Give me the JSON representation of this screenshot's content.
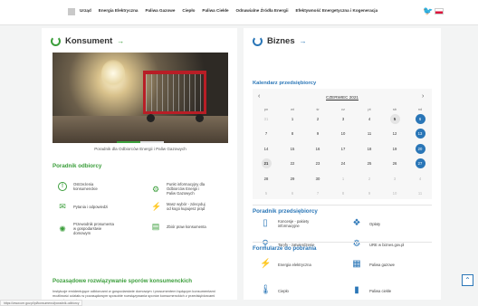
{
  "topnav": {
    "menu": [
      "Urząd",
      "Energia Elektryczna",
      "Paliwa Gazowe",
      "Ciepło",
      "Paliwa Ciekłe",
      "Odnawialne Źródła Energii",
      "Efektywność Energetyczna i Kogeneracja"
    ],
    "home_icon": "home-icon",
    "twitter_icon": "twitter-icon",
    "language_icon": "flag-icon"
  },
  "konsument": {
    "title": "Konsument",
    "arrow": "→",
    "slide_caption": "Poradnik dla Odbiorców Energii i Paliw Gazowych",
    "guide_heading": "Poradnik odbiorcy",
    "items": [
      {
        "label": "Ostrzeżenia konsumenckie",
        "icon": "warning-icon",
        "glyph": "!"
      },
      {
        "label": "Punkt informacyjny dla Odbiorców Energii i Paliw Gazowych",
        "icon": "info-point-icon",
        "glyph": "⚙"
      },
      {
        "label": "Pytania i odpowiedzi",
        "icon": "chat-icon",
        "glyph": "✉"
      },
      {
        "label": "Masz wybór - zdecyduj od kogo kupujesz prąd",
        "icon": "plug-icon",
        "glyph": "⚡"
      },
      {
        "label": "Przewodnik prosumenta w gospodarstwie domowym",
        "icon": "sun-icon",
        "glyph": "✺"
      },
      {
        "label": "Zbiór praw konsumenta",
        "icon": "book-icon",
        "glyph": "▤"
      }
    ],
    "disputes_heading": "Pozasądowe rozwiązywanie sporów konsumenckich",
    "disputes_text": "Instytucje emidentujące odbiorcami w gospodarstwie domowym i prosumentem będącym konsumentami możliwość udziału w pozasądowym sposobie rozwiązywania sporów konsumenckich z przedsiębiorcami energetycznymi"
  },
  "biznes": {
    "title": "Biznes",
    "arrow": "→",
    "calendar_heading": "Kalendarz przedsiębiorcy",
    "calendar": {
      "month": "CZERWIEC 2021",
      "prev": "‹",
      "next": "›",
      "dow": [
        "pn",
        "wt",
        "śr",
        "cz",
        "pt",
        "sb",
        "nd"
      ],
      "weeks": [
        [
          {
            "d": "31",
            "s": "dim"
          },
          {
            "d": "1"
          },
          {
            "d": "2"
          },
          {
            "d": "3"
          },
          {
            "d": "4"
          },
          {
            "d": "5",
            "s": "today"
          },
          {
            "d": "6",
            "s": "sel"
          }
        ],
        [
          {
            "d": "7"
          },
          {
            "d": "8"
          },
          {
            "d": "9"
          },
          {
            "d": "10"
          },
          {
            "d": "11"
          },
          {
            "d": "12"
          },
          {
            "d": "13",
            "s": "sel"
          }
        ],
        [
          {
            "d": "14"
          },
          {
            "d": "15"
          },
          {
            "d": "16"
          },
          {
            "d": "17"
          },
          {
            "d": "18"
          },
          {
            "d": "19"
          },
          {
            "d": "20",
            "s": "sel"
          }
        ],
        [
          {
            "d": "21",
            "s": "today"
          },
          {
            "d": "22"
          },
          {
            "d": "23"
          },
          {
            "d": "24"
          },
          {
            "d": "25"
          },
          {
            "d": "26"
          },
          {
            "d": "27",
            "s": "sel"
          }
        ],
        [
          {
            "d": "28"
          },
          {
            "d": "29"
          },
          {
            "d": "30"
          },
          {
            "d": "1",
            "s": "dim"
          },
          {
            "d": "2",
            "s": "dim"
          },
          {
            "d": "3",
            "s": "dim"
          },
          {
            "d": "4",
            "s": "dim"
          }
        ],
        [
          {
            "d": "5",
            "s": "dim"
          },
          {
            "d": "6",
            "s": "dim"
          },
          {
            "d": "7",
            "s": "dim"
          },
          {
            "d": "8",
            "s": "dim"
          },
          {
            "d": "9",
            "s": "dim"
          },
          {
            "d": "10",
            "s": "dim"
          },
          {
            "d": "11",
            "s": "dim"
          }
        ]
      ]
    },
    "guide_heading": "Poradnik przedsiębiorcy",
    "guide_items": [
      {
        "label": "Koncesje - pakiety informacyjne",
        "icon": "document-icon",
        "glyph": "▯"
      },
      {
        "label": "Opłaty",
        "icon": "fees-icon",
        "glyph": "❖"
      },
      {
        "label": "Taryfy - zatwierdzenie",
        "icon": "magnifier-icon",
        "glyph": "⚲"
      },
      {
        "label": "URE w biznes.gov.pl",
        "icon": "gears-icon",
        "glyph": "⚙"
      }
    ],
    "forms_heading": "Formularze do pobrania",
    "form_items": [
      {
        "label": "Energia elektryczna",
        "icon": "lightning-icon",
        "glyph": "⚡"
      },
      {
        "label": "Paliwa gazowe",
        "icon": "gas-icon",
        "glyph": "▦"
      },
      {
        "label": "Ciepło",
        "icon": "thermometer-icon",
        "glyph": "🌡"
      },
      {
        "label": "Paliwa ciekłe",
        "icon": "canister-icon",
        "glyph": "▮"
      }
    ]
  },
  "status_url": "https://www.ure.gov.pl/pl/konsumenci/poradnik-odbiorcy",
  "to_top": "⌃",
  "colors": {
    "green": "#3b9e3b",
    "blue": "#2a76b7",
    "flag_red": "#dc143c",
    "twitter": "#1da1f2"
  }
}
